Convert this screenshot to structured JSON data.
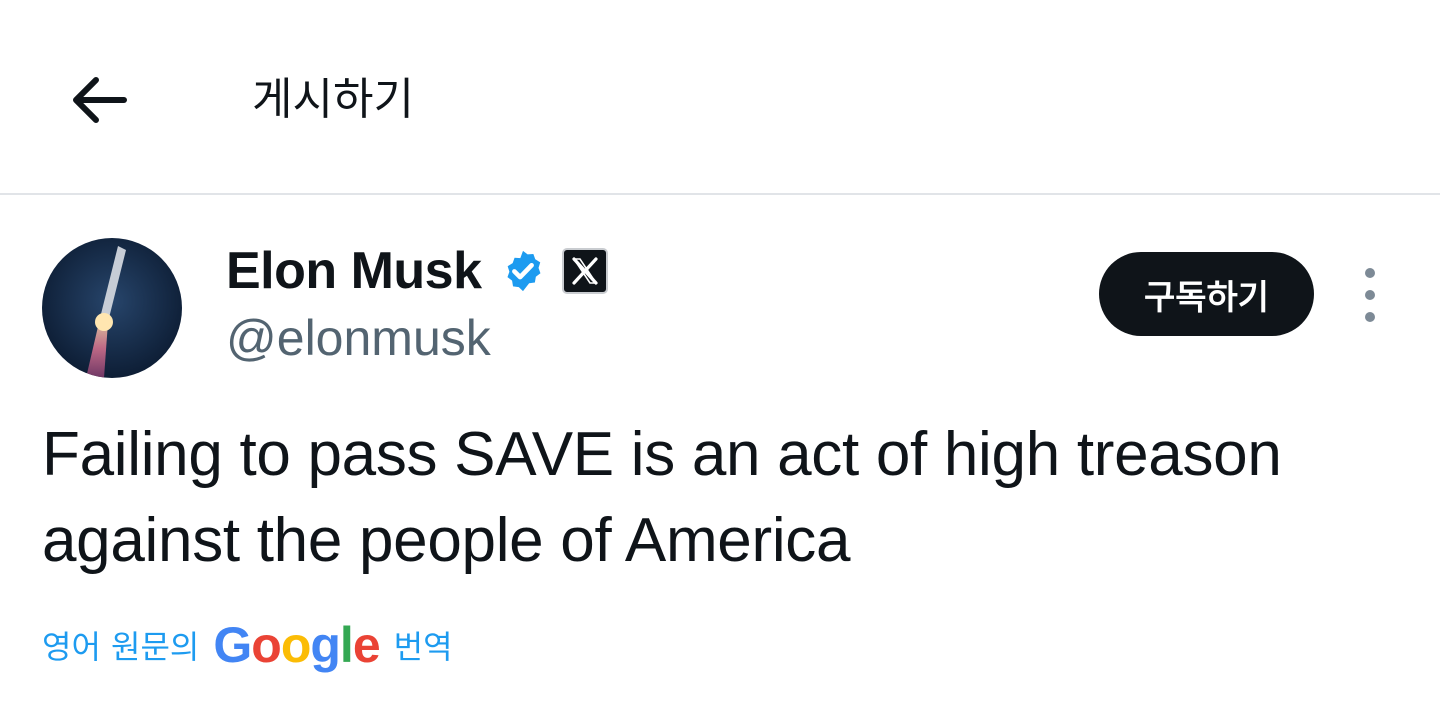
{
  "header": {
    "title": "게시하기",
    "back_icon": "arrow-left-icon"
  },
  "author": {
    "display_name": "Elon Musk",
    "handle": "@elonmusk",
    "verified_icon": "verified-badge-icon",
    "verified_color": "#1d9bf0",
    "affiliate_icon": "x-logo-icon"
  },
  "actions": {
    "subscribe_label": "구독하기",
    "more_icon": "more-vertical-icon"
  },
  "tweet": {
    "text": "Failing to pass SAVE is an act of high treason against the people of America"
  },
  "translate": {
    "prefix": "영어 원문의",
    "google_letters": [
      "G",
      "o",
      "o",
      "g",
      "l",
      "e"
    ],
    "google_colors": [
      "#4285F4",
      "#EA4335",
      "#FBBC05",
      "#4285F4",
      "#34A853",
      "#EA4335"
    ],
    "suffix": "번역"
  },
  "colors": {
    "accent": "#1d9bf0",
    "text_primary": "#0f1419",
    "text_secondary": "#536471"
  }
}
